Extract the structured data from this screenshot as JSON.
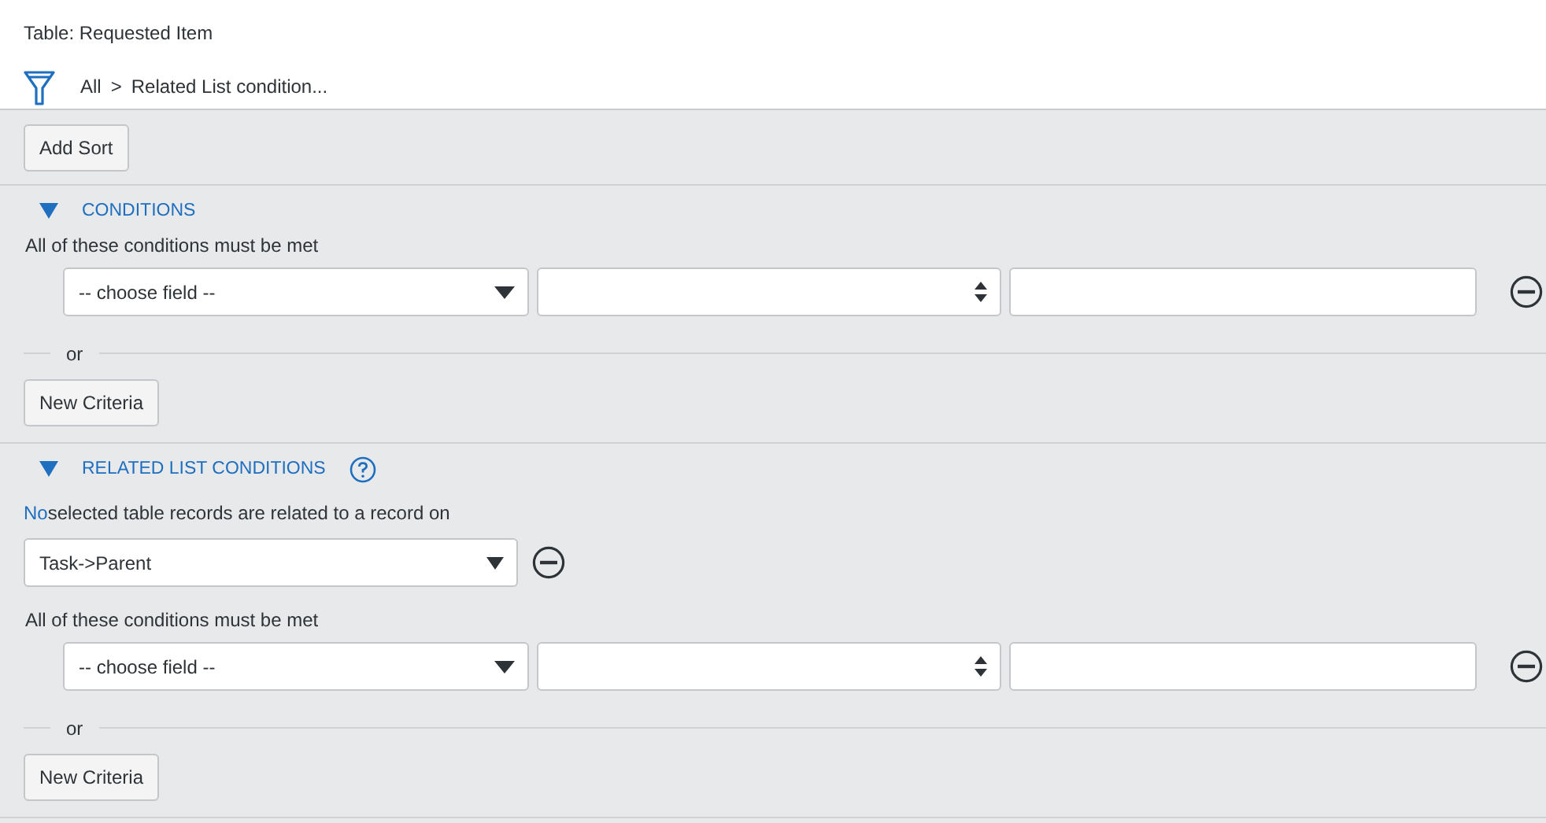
{
  "table_label": "Table: Requested Item",
  "breadcrumb": {
    "items": [
      "All",
      "Related List condition..."
    ],
    "separator": ">"
  },
  "add_sort_button": "Add Sort",
  "sections": [
    {
      "kind": "conditions",
      "title": "CONDITIONS",
      "expanded": true,
      "criteria": {
        "heading": "All of these conditions must be met",
        "rows": [
          {
            "field": "-- choose field --"
          }
        ],
        "or_label": "or",
        "new_criteria_button": "New Criteria"
      }
    },
    {
      "kind": "related",
      "title": "RELATED LIST CONDITIONS",
      "expanded": true,
      "help": true,
      "quantifier": "No",
      "sentence": "selected table records are related to a record on",
      "relation": "Task->Parent",
      "criteria": {
        "heading": "All of these conditions must be met",
        "rows": [
          {
            "field": "-- choose field --"
          }
        ],
        "or_label": "or",
        "new_criteria_button": "New Criteria"
      }
    }
  ]
}
